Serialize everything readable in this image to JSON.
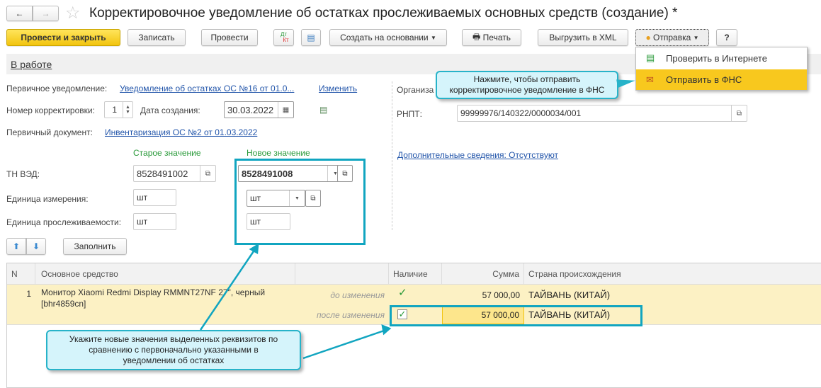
{
  "title": "Корректировочное уведомление об остатках прослеживаемых основных средств (создание) *",
  "toolbar": {
    "post_close": "Провести и закрыть",
    "save": "Записать",
    "post": "Провести",
    "dtkt_top": "Дт",
    "dtkt_bottom": "Кт",
    "create_based": "Создать на основании",
    "print": "Печать",
    "export_xml": "Выгрузить в XML",
    "send": "Отправка",
    "help": "?"
  },
  "status": "В работе",
  "menu": {
    "items": [
      {
        "label": "Проверить в Интернете"
      },
      {
        "label": "Отправить в ФНС"
      }
    ]
  },
  "callout_top": "Нажмите, чтобы отправить корректировочное уведомление в ФНС",
  "callout_bottom": "Укажите новые значения выделенных реквизитов по сравнению с первоначально указанными в уведомлении об остатках",
  "form": {
    "primary_notice_label": "Первичное уведомление:",
    "primary_notice_link": "Уведомление об остатках ОС №16 от 01.0...",
    "change": "Изменить",
    "corr_num_label": "Номер корректировки:",
    "corr_num": "1",
    "date_label": "Дата создания:",
    "date": "30.03.2022",
    "primary_doc_label": "Первичный документ:",
    "primary_doc_link": "Инвентаризация ОС №2 от 01.03.2022",
    "old_header": "Старое значение",
    "new_header": "Новое значение",
    "tnved_label": "ТН ВЭД:",
    "tnved_old": "8528491002",
    "tnved_new": "8528491008",
    "unit_label": "Единица измерения:",
    "unit_old": "шт",
    "unit_new": "шт",
    "trace_unit_label": "Единица прослеживаемости:",
    "trace_old": "шт",
    "trace_new": "шт",
    "org_label": "Организа",
    "rnpt_label": "РНПТ:",
    "rnpt": "99999976/140322/0000034/001",
    "extra_link": "Дополнительные сведения: Отсутствуют",
    "fill": "Заполнить"
  },
  "table": {
    "headers": [
      "N",
      "Основное средство",
      "",
      "Наличие",
      "Сумма",
      "Страна происхождения"
    ],
    "row": {
      "n": "1",
      "asset": "Монитор Xiaomi Redmi Display RMMNT27NF 27\", черный [bhr4859cn]",
      "before": "до изменения",
      "after": "после изменения",
      "sum_before": "57 000,00",
      "sum_after": "57 000,00",
      "country_before": "ТАЙВАНЬ (КИТАЙ)",
      "country_after": "ТАЙВАНЬ (КИТАЙ)"
    }
  }
}
